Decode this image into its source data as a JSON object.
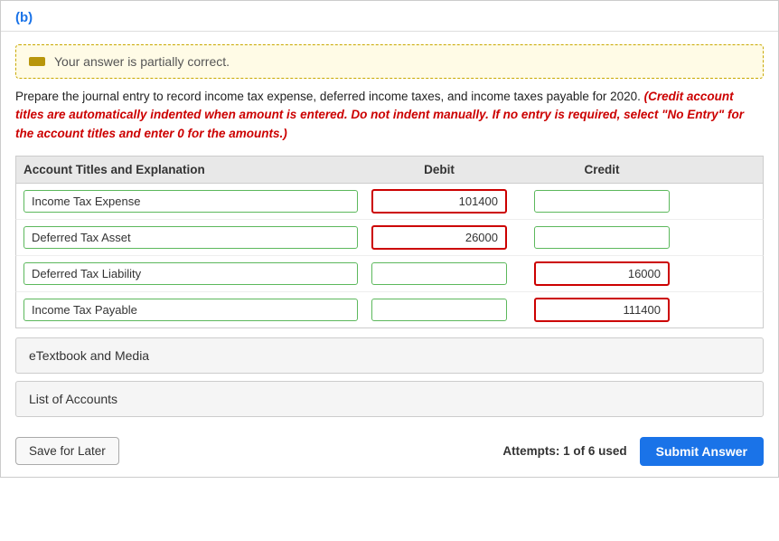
{
  "section": {
    "label": "(b)"
  },
  "partial_correct": {
    "icon_label": "minus",
    "text": "Your answer is partially correct."
  },
  "instructions": {
    "normal": "Prepare the journal entry to record income tax expense, deferred income taxes, and income taxes payable for 2020. ",
    "red": "(Credit account titles are automatically indented when amount is entered. Do not indent manually. If no entry is required, select \"No Entry\" for the account titles and enter 0 for the amounts.)"
  },
  "table": {
    "headers": {
      "account": "Account Titles and Explanation",
      "debit": "Debit",
      "credit": "Credit"
    },
    "rows": [
      {
        "account": "Income Tax Expense",
        "debit": "101400",
        "credit": "",
        "debit_border": "red",
        "credit_border": "green"
      },
      {
        "account": "Deferred Tax Asset",
        "debit": "26000",
        "credit": "",
        "debit_border": "red",
        "credit_border": "green"
      },
      {
        "account": "Deferred Tax Liability",
        "debit": "",
        "credit": "16000",
        "debit_border": "green",
        "credit_border": "red"
      },
      {
        "account": "Income Tax Payable",
        "debit": "",
        "credit": "111400",
        "debit_border": "green",
        "credit_border": "red"
      }
    ]
  },
  "collapsibles": [
    {
      "label": "eTextbook and Media"
    },
    {
      "label": "List of Accounts"
    }
  ],
  "footer": {
    "save_label": "Save for Later",
    "attempts_text": "Attempts: 1 of 6 used",
    "submit_label": "Submit Answer"
  }
}
